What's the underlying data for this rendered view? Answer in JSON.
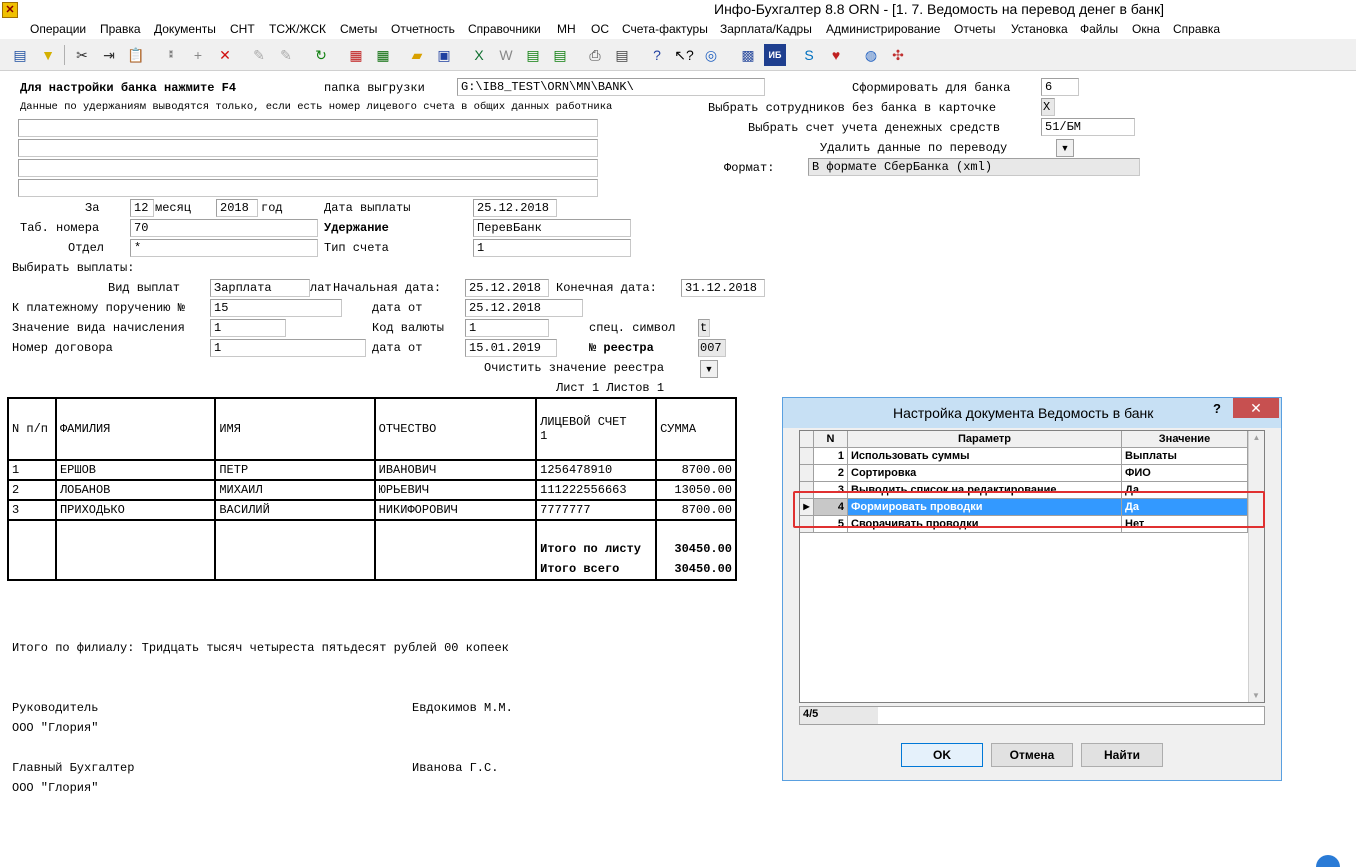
{
  "window": {
    "title": "Инфо-Бухгалтер 8.8   ORN   - [1. 7. Ведомость на перевод денег в банк]"
  },
  "menu": [
    "Операции",
    "Правка",
    "Документы",
    "СНТ",
    "ТСЖ/ЖСК",
    "Сметы",
    "Отчетность",
    "Справочники",
    "МН",
    "ОС",
    "Счета-фактуры",
    "Зарплата/Кадры",
    "Администрирование",
    "Отчеты",
    "Установка",
    "Файлы",
    "Окна",
    "Справка"
  ],
  "form": {
    "bank_hint": "Для настройки банка нажмите F4",
    "export_folder_label": "папка выгрузки",
    "export_folder_value": "G:\\IB8_TEST\\ORN\\MN\\BANK\\",
    "form_for_bank_label": "Сформировать для банка",
    "form_for_bank_value": "6",
    "withholding_note": "Данные по удержаниям выводятся только, если есть номер лицевого счета в общих данных работника",
    "employees_no_bank_label": "Выбрать сотрудников без банка в карточке",
    "employees_no_bank_value": "X",
    "account_label": "Выбрать счет учета денежных средств",
    "account_value": "51/БМ",
    "delete_transfer_label": "Удалить данные по переводу",
    "format_label": "Формат:",
    "format_value": "В формате СберБанка (xml)",
    "period_label": "За",
    "month_value": "12",
    "month_label": "месяц",
    "year_value": "2018",
    "year_label": "год",
    "pay_date_label": "Дата выплаты",
    "pay_date_value": "25.12.2018",
    "tab_numbers_label": "Таб. номера",
    "tab_numbers_value": "70",
    "withholding_label": "Удержание",
    "withholding_value": "ПеревБанк",
    "dept_label": "Отдел",
    "dept_value": "*",
    "account_type_label": "Тип счета",
    "account_type_value": "1",
    "choose_payments_label": "Выбирать выплаты:",
    "payment_kind_label": "Вид выплат",
    "payment_kind_value": "Зарплата",
    "payment_kind_overflow": "лат",
    "start_date_label": "Начальная дата:",
    "start_date_value": "25.12.2018",
    "end_date_label": "Конечная дата:",
    "end_date_value": "31.12.2018",
    "payment_order_label": "К платежному поручению №",
    "payment_order_value": "15",
    "date_from_label": "дата от",
    "date_from_value": "25.12.2018",
    "accrual_value_label": "Значение вида начисления",
    "accrual_value_value": "1",
    "currency_code_label": "Код валюты",
    "currency_code_value": "1",
    "special_symbol_label": "спец. символ",
    "special_symbol_value": "t",
    "contract_label": "Номер договора",
    "contract_value": "1",
    "date_from2_label": "дата от",
    "date_from2_value": "15.01.2019",
    "registry_label": "№ реестра",
    "registry_value": "007",
    "clear_registry_label": "Очистить значение реестра",
    "sheet_info": "Лист 1  Листов 1"
  },
  "table": {
    "headers": [
      "N п/п",
      "ФАМИЛИЯ",
      "ИМЯ",
      "ОТЧЕСТВО",
      "ЛИЦЕВОЙ СЧЕТ",
      "СУММА"
    ],
    "header_sub": "1",
    "rows": [
      [
        "1",
        "ЕРШОВ",
        "ПЕТР",
        "ИВАНОВИЧ",
        "1256478910",
        "8700.00"
      ],
      [
        "2",
        "ЛОБАНОВ",
        "МИХАИЛ",
        "ЮРЬЕВИЧ",
        "111222556663",
        "13050.00"
      ],
      [
        "3",
        "ПРИХОДЬКО",
        "ВАСИЛИЙ",
        "НИКИФОРОВИЧ",
        "7777777",
        "8700.00"
      ]
    ],
    "total_sheet_label": "Итого по листу",
    "total_sheet_value": "30450.00",
    "total_all_label": "Итого всего",
    "total_all_value": "30450.00"
  },
  "footer": {
    "branch_total": "Итого по филиалу: Тридцать тысяч четыреста пятьдесят рублей 00 копеек",
    "head_label": "Руководитель",
    "head_name": "Евдокимов М.М.",
    "org1": "ООО \"Глория\"",
    "chief_acc_label": "Главный Бухгалтер",
    "chief_acc_name": "Иванова Г.С.",
    "org2": "ООО \"Глория\""
  },
  "dialog": {
    "title": "Настройка документа Ведомость в банк",
    "help": "?",
    "close": "✕",
    "columns": [
      "N",
      "Параметр",
      "Значение"
    ],
    "rows": [
      {
        "n": "1",
        "param": "Использовать суммы",
        "value": "Выплаты"
      },
      {
        "n": "2",
        "param": "Сортировка",
        "value": "ФИО"
      },
      {
        "n": "3",
        "param": "Выводить список на редактирование",
        "value": "Да"
      },
      {
        "n": "4",
        "param": "Формировать проводки",
        "value": "Да"
      },
      {
        "n": "5",
        "param": "Сворачивать проводки",
        "value": "Нет"
      }
    ],
    "selected_row": 4,
    "status": "4/5",
    "ok": "OK",
    "cancel": "Отмена",
    "find": "Найти"
  },
  "colors": {
    "selection": "#3399ff",
    "highlight_frame": "#e03030",
    "dialog_title": "#c7e0f4"
  }
}
